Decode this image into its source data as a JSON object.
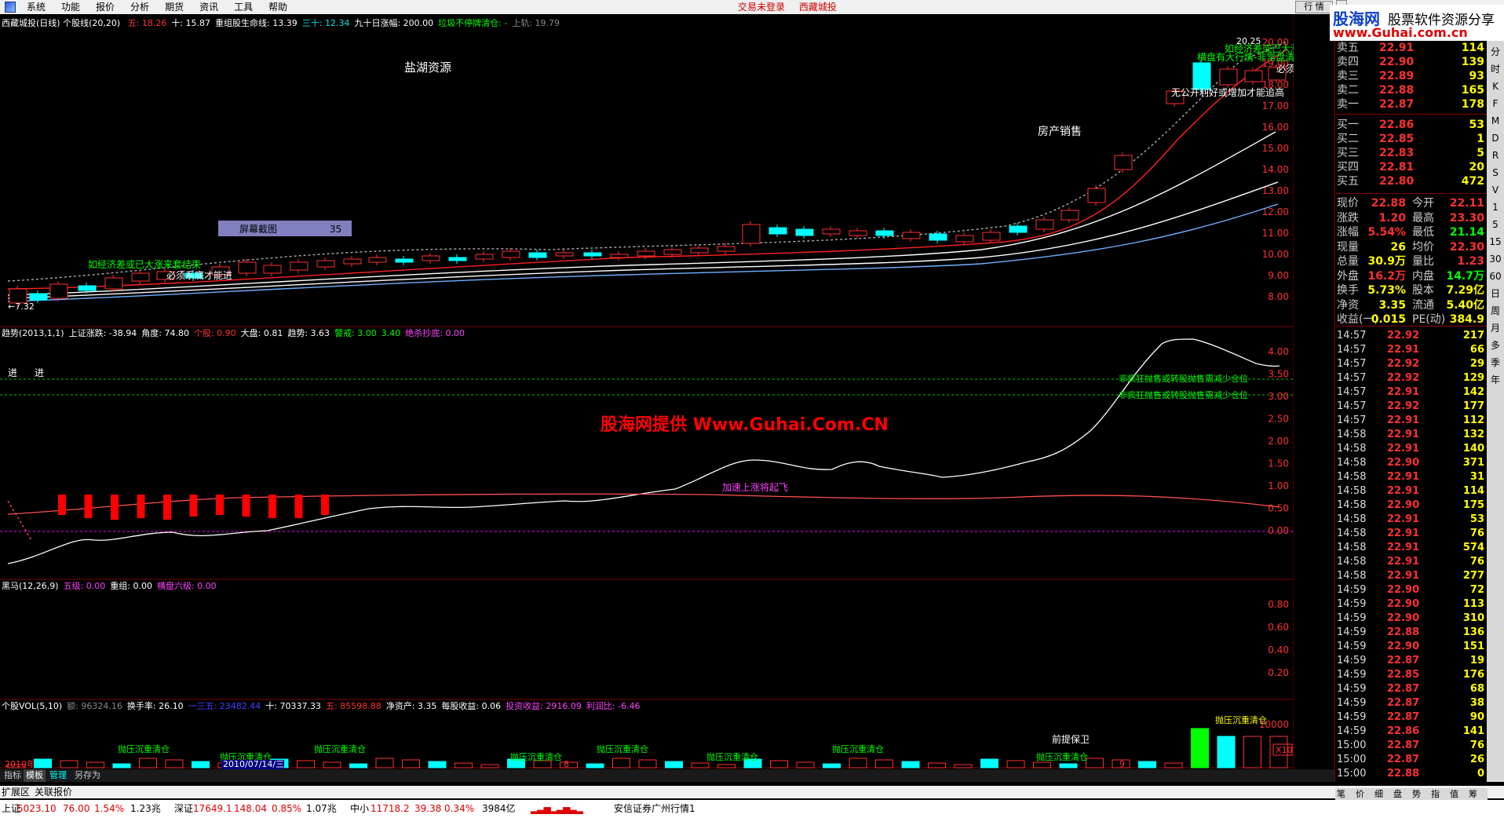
{
  "menu": {
    "items": [
      "系统",
      "功能",
      "报价",
      "分析",
      "期货",
      "资讯",
      "工具",
      "帮助"
    ],
    "status_left": "交易未登录",
    "status_right": "西藏城投",
    "mode_button": "行 情"
  },
  "logo": {
    "brand": "股海网",
    "tagline": "股票软件资源分享",
    "url": "www.Guhai.com.cn"
  },
  "main_chart": {
    "title": "西藏城投(日线) 个股线(20,20)",
    "indicators": [
      {
        "label": "五: 18.26",
        "color": "#ff3030"
      },
      {
        "label": "十: 15.87",
        "color": "#ffffff"
      },
      {
        "label": "重组股生命线: 13.39",
        "color": "#ffffff"
      },
      {
        "label": "三十: 12.34",
        "color": "#00e0e0"
      },
      {
        "label": "九十日涨幅: 200.00",
        "color": "#ffffff"
      },
      {
        "label": "垃圾不停牌清仓: -",
        "color": "#00ff00"
      },
      {
        "label": "上轨: 19.79",
        "color": "#888888"
      }
    ],
    "y_ticks": [
      "20.00",
      "19.00",
      "18.00",
      "17.00",
      "16.00",
      "15.00",
      "14.00",
      "13.00",
      "12.00",
      "11.00",
      "10.00",
      "9.00",
      "8.00"
    ],
    "annotations": {
      "salt_lake": "盐湖资源",
      "property": "房产销售",
      "screenshot_label": "屏幕截图",
      "screenshot_value": "35",
      "low_label": "←7.32",
      "high_label": "20.25",
      "green_note_left": "如经济差或已大涨来套结束",
      "white_note_left": "必须系底才能进",
      "note_top_right": "无公开利好或增加才能追高",
      "green_note_tr1": "如经济差或已大涨",
      "green_note_tr2": "横盘有大行情-非常盘清",
      "white_note_tr": "必须"
    }
  },
  "trend_panel": {
    "indicators": [
      {
        "label": "趋势(2013,1,1)",
        "color": "#ffffff"
      },
      {
        "label": "上证涨跌: -38.94",
        "color": "#ffffff"
      },
      {
        "label": "角度: 74.80",
        "color": "#ffffff"
      },
      {
        "label": "个股: 0.90",
        "color": "#ff3030"
      },
      {
        "label": "大盘: 0.81",
        "color": "#ffffff"
      },
      {
        "label": "趋势: 3.63",
        "color": "#ffffff"
      },
      {
        "label": "警戒: 3.00",
        "color": "#00ff00"
      },
      {
        "label": "3.40",
        "color": "#00ff00"
      },
      {
        "label": "绝杀抄底: 0.00",
        "color": "#ff40ff"
      }
    ],
    "y_ticks": [
      "4.00",
      "3.50",
      "3.00",
      "2.50",
      "2.00",
      "1.50",
      "1.00",
      "0.50",
      "0.00"
    ],
    "jin1": "进",
    "jin2": "进",
    "watermark": "股海网提供 Www.Guhai.Com.CN",
    "accel": "加速上涨将起飞",
    "green_warn": "非疯狂抛售或转股抛售需减少仓位"
  },
  "horse_panel": {
    "indicators": [
      {
        "label": "黑马(12,26,9)",
        "color": "#ffffff"
      },
      {
        "label": "五级: 0.00",
        "color": "#ff40ff"
      },
      {
        "label": "重组: 0.00",
        "color": "#ffffff"
      },
      {
        "label": "横盘六级: 0.00",
        "color": "#ff40ff"
      }
    ],
    "y_ticks": [
      "0.80",
      "0.60",
      "0.40",
      "0.20"
    ]
  },
  "vol_panel": {
    "indicators": [
      {
        "label": "个股VOL(5,10)",
        "color": "#ffffff"
      },
      {
        "label": "额: 96324.16",
        "color": "#888888"
      },
      {
        "label": "换手率: 26.10",
        "color": "#ffffff"
      },
      {
        "label": "一三五: 23482.44",
        "color": "#4040ff"
      },
      {
        "label": "十: 70337.33",
        "color": "#ffffff"
      },
      {
        "label": "五: 85598.88",
        "color": "#ff3030"
      },
      {
        "label": "净资产: 3.35",
        "color": "#ffffff"
      },
      {
        "label": "每股收益: 0.06",
        "color": "#ffffff"
      },
      {
        "label": "投资收益: 2916.09",
        "color": "#ff40ff"
      },
      {
        "label": "利润比: -6.46",
        "color": "#ff40ff"
      }
    ],
    "y_tick": "10000",
    "x10": "X10",
    "green_tags": [
      "抛压沉重清仓",
      "抛压沉重清仓",
      "抛压沉重清仓",
      "抛压沉重清仓",
      "抛压沉重清仓",
      "抛压沉重清仓",
      "抛压沉重清仓",
      "抛压沉重清仓"
    ],
    "vol_note": "抛压沉重清仓",
    "final_label": "前提保卫"
  },
  "time_axis": {
    "year": "2010年",
    "cursor_date": "2010/07/14/三",
    "month_8": "8",
    "month_9": "9",
    "period": "日线"
  },
  "tabs": [
    "指标",
    "模板",
    "管理",
    "另存为"
  ],
  "ext_bar": [
    "扩展区",
    "关联报价"
  ],
  "order_book": {
    "sells": [
      {
        "label": "卖五",
        "price": "22.91",
        "vol": "114"
      },
      {
        "label": "卖四",
        "price": "22.90",
        "vol": "139"
      },
      {
        "label": "卖三",
        "price": "22.89",
        "vol": "93"
      },
      {
        "label": "卖二",
        "price": "22.88",
        "vol": "165"
      },
      {
        "label": "卖一",
        "price": "22.87",
        "vol": "178"
      }
    ],
    "buys": [
      {
        "label": "买一",
        "price": "22.86",
        "vol": "53"
      },
      {
        "label": "买二",
        "price": "22.85",
        "vol": "1"
      },
      {
        "label": "买三",
        "price": "22.83",
        "vol": "5"
      },
      {
        "label": "买四",
        "price": "22.81",
        "vol": "20"
      },
      {
        "label": "买五",
        "price": "22.80",
        "vol": "472"
      }
    ]
  },
  "stats": [
    {
      "k1": "现价",
      "v1": "22.88",
      "c1": "#ff3030",
      "k2": "今开",
      "v2": "22.11",
      "c2": "#ff3030"
    },
    {
      "k1": "涨跌",
      "v1": "1.20",
      "c1": "#ff3030",
      "k2": "最高",
      "v2": "23.30",
      "c2": "#ff3030"
    },
    {
      "k1": "涨幅",
      "v1": "5.54%",
      "c1": "#ff3030",
      "k2": "最低",
      "v2": "21.14",
      "c2": "#00ff00"
    },
    {
      "k1": "现量",
      "v1": "26",
      "c1": "#ffff00",
      "k2": "均价",
      "v2": "22.30",
      "c2": "#ff3030"
    },
    {
      "k1": "总量",
      "v1": "30.9万",
      "c1": "#ffff00",
      "k2": "量比",
      "v2": "1.23",
      "c2": "#ff3030"
    },
    {
      "k1": "外盘",
      "v1": "16.2万",
      "c1": "#ff3030",
      "k2": "内盘",
      "v2": "14.7万",
      "c2": "#00ff00"
    },
    {
      "k1": "换手",
      "v1": "5.73%",
      "c1": "#ffff00",
      "k2": "股本",
      "v2": "7.29亿",
      "c2": "#ffff00"
    },
    {
      "k1": "净资",
      "v1": "3.35",
      "c1": "#ffff00",
      "k2": "流通",
      "v2": "5.40亿",
      "c2": "#ffff00"
    },
    {
      "k1": "收益(一)",
      "v1": "0.015",
      "c1": "#ffff00",
      "k2": "PE(动)",
      "v2": "384.9",
      "c2": "#ffff00"
    }
  ],
  "ticks": [
    {
      "t": "14:57",
      "p": "22.92",
      "v": "217"
    },
    {
      "t": "14:57",
      "p": "22.91",
      "v": "66"
    },
    {
      "t": "14:57",
      "p": "22.92",
      "v": "29"
    },
    {
      "t": "14:57",
      "p": "22.92",
      "v": "129"
    },
    {
      "t": "14:57",
      "p": "22.91",
      "v": "142"
    },
    {
      "t": "14:57",
      "p": "22.92",
      "v": "177"
    },
    {
      "t": "14:57",
      "p": "22.91",
      "v": "112"
    },
    {
      "t": "14:58",
      "p": "22.91",
      "v": "132"
    },
    {
      "t": "14:58",
      "p": "22.91",
      "v": "140"
    },
    {
      "t": "14:58",
      "p": "22.90",
      "v": "371"
    },
    {
      "t": "14:58",
      "p": "22.91",
      "v": "31"
    },
    {
      "t": "14:58",
      "p": "22.91",
      "v": "114"
    },
    {
      "t": "14:58",
      "p": "22.90",
      "v": "175"
    },
    {
      "t": "14:58",
      "p": "22.91",
      "v": "53"
    },
    {
      "t": "14:58",
      "p": "22.91",
      "v": "76"
    },
    {
      "t": "14:58",
      "p": "22.91",
      "v": "574"
    },
    {
      "t": "14:58",
      "p": "22.91",
      "v": "76"
    },
    {
      "t": "14:58",
      "p": "22.91",
      "v": "277"
    },
    {
      "t": "14:59",
      "p": "22.90",
      "v": "72"
    },
    {
      "t": "14:59",
      "p": "22.90",
      "v": "113"
    },
    {
      "t": "14:59",
      "p": "22.90",
      "v": "310"
    },
    {
      "t": "14:59",
      "p": "22.88",
      "v": "136"
    },
    {
      "t": "14:59",
      "p": "22.90",
      "v": "151"
    },
    {
      "t": "14:59",
      "p": "22.87",
      "v": "19"
    },
    {
      "t": "14:59",
      "p": "22.85",
      "v": "176"
    },
    {
      "t": "14:59",
      "p": "22.87",
      "v": "68"
    },
    {
      "t": "14:59",
      "p": "22.87",
      "v": "38"
    },
    {
      "t": "14:59",
      "p": "22.87",
      "v": "90"
    },
    {
      "t": "14:59",
      "p": "22.86",
      "v": "141"
    },
    {
      "t": "15:00",
      "p": "22.87",
      "v": "76"
    },
    {
      "t": "15:00",
      "p": "22.87",
      "v": "26"
    },
    {
      "t": "15:00",
      "p": "22.88",
      "v": "0"
    }
  ],
  "right_tools": [
    "分",
    "时",
    "K",
    "F",
    "M",
    "D",
    "R",
    "S",
    "V",
    "1",
    "5",
    "15",
    "30",
    "60",
    "日",
    "周",
    "月",
    "多",
    "季",
    "年"
  ],
  "quote_tabs": [
    "笔",
    "价",
    "细",
    "盘",
    "势",
    "指",
    "值",
    "筹"
  ],
  "status": {
    "sh_label": "上证",
    "sh_index": "5023.10",
    "sh_change": "76.00",
    "sh_pct": "1.54%",
    "sh_amount": "1.23兆",
    "sz_label": "深证",
    "sz_index": "17649.1",
    "sz_change": "148.04",
    "sz_pct": "0.85%",
    "sz_amount": "1.07兆",
    "zx_label": "中小",
    "zx_index": "11718.2",
    "zx_change": "39.38",
    "zx_pct": "0.34%",
    "zx_amount": "3984亿",
    "broker": "安信证券广州行情1"
  },
  "colors": {
    "up": "#ff3030",
    "down": "#00ffff",
    "grid": "#800000",
    "ma5": "#ffffff",
    "ma10": "#ff2020",
    "ma20": "#ffffff",
    "ma30": "#80c0ff"
  }
}
